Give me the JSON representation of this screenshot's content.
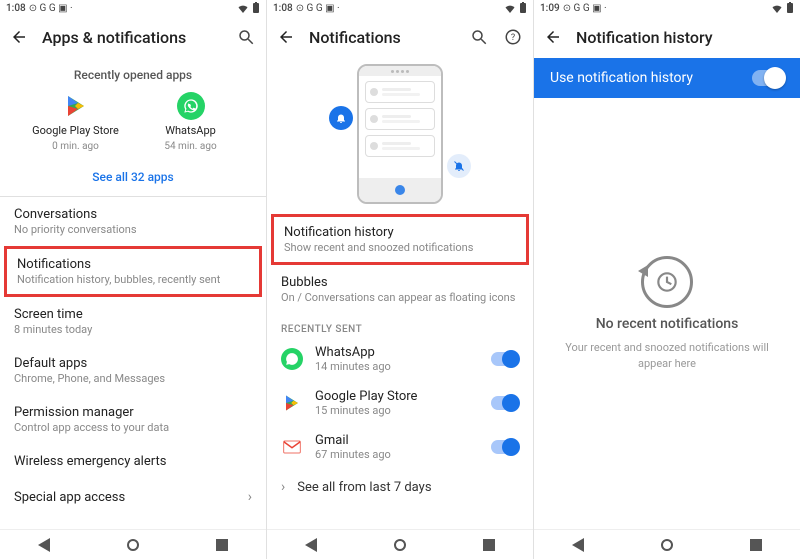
{
  "panel1": {
    "status": {
      "time": "1:08",
      "icons": "⊙ G G ▣ ·"
    },
    "title": "Apps & notifications",
    "recently_opened_label": "Recently opened apps",
    "apps": [
      {
        "name": "Google Play Store",
        "sub": "0 min. ago"
      },
      {
        "name": "WhatsApp",
        "sub": "54 min. ago"
      }
    ],
    "see_all": "See all 32 apps",
    "settings": [
      {
        "title": "Conversations",
        "sub": "No priority conversations",
        "hl": false
      },
      {
        "title": "Notifications",
        "sub": "Notification history, bubbles, recently sent",
        "hl": true
      },
      {
        "title": "Screen time",
        "sub": "8 minutes today",
        "hl": false
      },
      {
        "title": "Default apps",
        "sub": "Chrome, Phone, and Messages",
        "hl": false
      },
      {
        "title": "Permission manager",
        "sub": "Control app access to your data",
        "hl": false
      },
      {
        "title": "Wireless emergency alerts",
        "sub": "",
        "hl": false
      },
      {
        "title": "Special app access",
        "sub": "",
        "hl": false
      }
    ]
  },
  "panel2": {
    "status": {
      "time": "1:08",
      "icons": "⊙ G G ▣ ·"
    },
    "title": "Notifications",
    "settings": [
      {
        "title": "Notification history",
        "sub": "Show recent and snoozed notifications",
        "hl": true
      },
      {
        "title": "Bubbles",
        "sub": "On / Conversations can appear as floating icons",
        "hl": false
      }
    ],
    "recently_sent_label": "RECENTLY SENT",
    "recent": [
      {
        "name": "WhatsApp",
        "sub": "14 minutes ago",
        "color": "#25D366"
      },
      {
        "name": "Google Play Store",
        "sub": "15 minutes ago",
        "color": "#ffffff"
      },
      {
        "name": "Gmail",
        "sub": "67 minutes ago",
        "color": "#ffffff"
      }
    ],
    "see_all": "See all from last 7 days"
  },
  "panel3": {
    "status": {
      "time": "1:09",
      "icons": "⊙ G G ▣ ·"
    },
    "title": "Notification history",
    "banner": "Use notification history",
    "empty_title": "No recent notifications",
    "empty_sub": "Your recent and snoozed notifications will appear here"
  }
}
